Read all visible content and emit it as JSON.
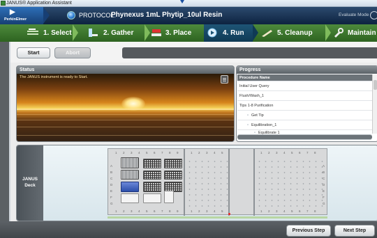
{
  "window": {
    "title": "JANUS® Application Assistant"
  },
  "protocol": {
    "brand": "PerkinElmer",
    "label": "PROTOCOL:",
    "name": "Phynexus 1mL Phytip_10ul Resin",
    "mode": "Evaluate Mode"
  },
  "steps": [
    {
      "label": "1. Select",
      "icon": "select-icon"
    },
    {
      "label": "2. Gather",
      "icon": "gather-icon"
    },
    {
      "label": "3. Place",
      "icon": "place-icon"
    },
    {
      "label": "4. Run",
      "icon": "run-icon",
      "active": true
    },
    {
      "label": "5. Cleanup",
      "icon": "cleanup-icon"
    },
    {
      "label": "Maintain",
      "icon": "wrench-icon"
    }
  ],
  "toolbar": {
    "start_label": "Start",
    "abort_label": "Abort"
  },
  "status": {
    "title": "Status",
    "message": "The JANUS instrument is ready to Start."
  },
  "progress": {
    "title": "Progress",
    "header": "Procedure Name",
    "rows": [
      {
        "text": "Initial User Query",
        "indent": 0
      },
      {
        "text": "Flush/Wash_1",
        "indent": 0
      },
      {
        "text": "Tips 1-8 Purification",
        "indent": 0
      },
      {
        "text": "Get Tip",
        "indent": 1
      },
      {
        "text": "Equilibration_1",
        "indent": 1
      },
      {
        "text": "Equilibrate 1",
        "indent": 2
      }
    ]
  },
  "deck": {
    "label_line1": "JANUS",
    "label_line2": "Deck",
    "row_letters": [
      "A",
      "B",
      "C",
      "D",
      "E",
      "F",
      "G"
    ],
    "col_numbers": [
      "1",
      "2",
      "3",
      "4",
      "5",
      "6",
      "7",
      "8",
      "9"
    ]
  },
  "footer": {
    "prev_label": "Previous Step",
    "next_label": "Next Step"
  },
  "colors": {
    "steps_green": "#2d6320",
    "active_step": "#0f3a55",
    "header_navy": "#0d2340"
  }
}
